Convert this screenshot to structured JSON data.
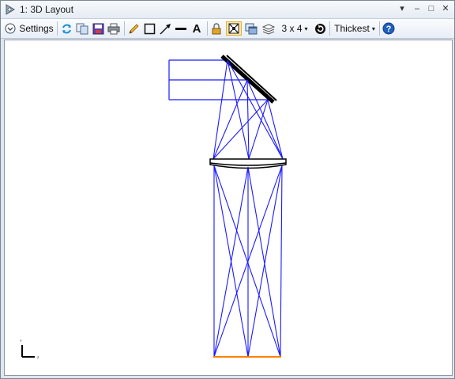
{
  "window": {
    "title": "1: 3D Layout",
    "controls": {
      "dropdown": "▾",
      "minimize": "–",
      "maximize": "□",
      "close": "✕"
    }
  },
  "toolbar": {
    "settings_label": "Settings",
    "config_label": "3 x 4",
    "thickness_label": "Thickest",
    "dropdown_caret": "▾",
    "text_tool_glyph": "A"
  },
  "axis_indicator": {
    "y_label": "Y",
    "z_label": "Z"
  },
  "colors": {
    "ray": "#1a1aff",
    "image_surface": "#ff8000",
    "element": "#000000",
    "help": "#1f5fbf",
    "refresh": "#1a8fe0"
  }
}
